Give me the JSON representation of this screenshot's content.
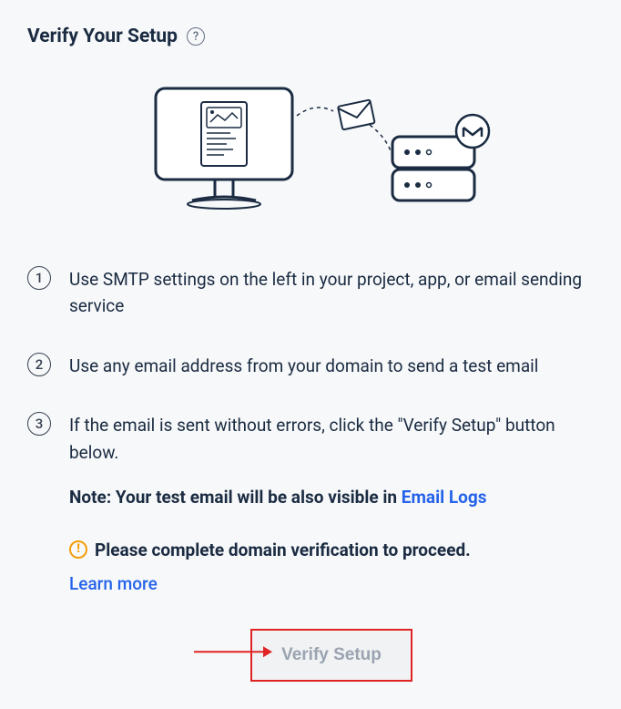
{
  "header": {
    "title": "Verify Your Setup"
  },
  "steps": {
    "s1": {
      "num": "1",
      "text": "Use SMTP settings on the left in your project, app, or email sending service"
    },
    "s2": {
      "num": "2",
      "text": "Use any email address from your domain to send a test email"
    },
    "s3": {
      "num": "3",
      "text": "If the email is sent without errors, click the \"Verify Setup\" button below."
    }
  },
  "note": {
    "prefix": "Note: Your test email will be also visible in ",
    "link_text": "Email Logs"
  },
  "warning": {
    "text": "Please complete domain verification to proceed.",
    "learn_more": "Learn more"
  },
  "button": {
    "verify": "Verify Setup"
  }
}
